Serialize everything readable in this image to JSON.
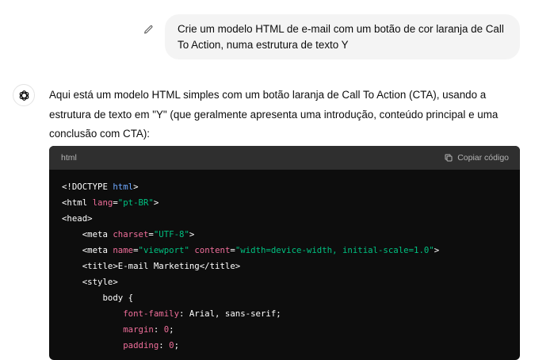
{
  "user_message": {
    "line1": "Crie um modelo HTML de e-mail com um botão de cor laranja de Call",
    "line2": "To Action, numa estrutura de texto Y",
    "edit_icon": "pencil-icon"
  },
  "assistant": {
    "avatar_icon": "openai-logo-icon",
    "intro_line1": "Aqui está um modelo HTML simples com um botão laranja de Call To Action (CTA), usando a",
    "intro_line2": "estrutura de texto em \"Y\" (que geralmente apresenta uma introdução, conteúdo principal e uma",
    "intro_line3": "conclusão com CTA):"
  },
  "code_block": {
    "language": "html",
    "copy_label": "Copiar código",
    "copy_icon": "copy-icon",
    "lines": {
      "l1": {
        "a": "<!DOCTYPE ",
        "b": "html",
        "c": ">"
      },
      "l2": {
        "a": "<html ",
        "b": "lang",
        "c": "=",
        "d": "\"pt-BR\"",
        "e": ">"
      },
      "l3": {
        "a": "<head>"
      },
      "l4": {
        "a": "<meta ",
        "b": "charset",
        "c": "=",
        "d": "\"UTF-8\"",
        "e": ">"
      },
      "l5": {
        "a": "<meta ",
        "b": "name",
        "c": "=",
        "d": "\"viewport\"",
        "e": " content",
        "f": "=",
        "g": "\"width=device-width, initial-scale=1.0\"",
        "h": ">"
      },
      "l6": {
        "a": "<title>E-mail Marketing</title>"
      },
      "l7": {
        "a": "<style>"
      },
      "l8": {
        "a": "body {"
      },
      "l9": {
        "a": "font-family",
        "b": ": Arial, sans-serif;"
      },
      "l10": {
        "a": "margin",
        "b": ": ",
        "c": "0",
        "d": ";"
      },
      "l11": {
        "a": "padding",
        "b": ": ",
        "c": "0",
        "d": ";"
      }
    }
  },
  "colors": {
    "code_bg": "#0d0d0d",
    "code_header_bg": "#2f2f2f",
    "user_bubble_bg": "#f4f4f4",
    "string": "#00c080",
    "attribute": "#ef6e9a",
    "keyword": "#6ea8fe"
  }
}
